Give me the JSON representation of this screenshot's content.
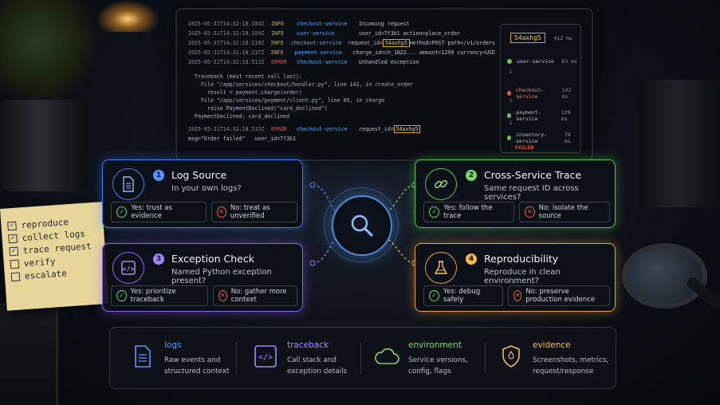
{
  "colors": {
    "blue": "#3f7cf0",
    "green": "#57c34a",
    "purple": "#8a5ff0",
    "orange": "#e3a12f",
    "error": "#e05a3c",
    "highlight": "#e0a22b"
  },
  "sticky_note": {
    "items": [
      {
        "label": "reproduce",
        "checked": true
      },
      {
        "label": "collect logs",
        "checked": true
      },
      {
        "label": "trace request",
        "checked": true
      },
      {
        "label": "verify",
        "checked": false
      },
      {
        "label": "escalate",
        "checked": false
      }
    ]
  },
  "terminal": {
    "log_lines": [
      {
        "ts": "2025-05-21T14:32:18.104Z",
        "level": "INFO",
        "service": "checkout-service",
        "msg": "Incoming request"
      },
      {
        "ts": "2025-05-21T14:32:18.109Z",
        "level": "INFO",
        "service": "user-service",
        "msg": "user_id=7f3b1  action=place_order"
      },
      {
        "ts": "2025-05-21T14:32:18.118Z",
        "level": "INFO",
        "service": "checkout-service",
        "msg_pre": "request_id=",
        "msg_hl": "54axhg5",
        "msg_post": "method=POST path=/v1/orders"
      },
      {
        "ts": "2025-05-21T14:32:18.237Z",
        "level": "INFO",
        "service": "payment-service",
        "msg": "charge_id=ch_1N22...  amount=1299  currency=USD"
      },
      {
        "ts": "2025-05-21T14:32:18.512Z",
        "level": "ERROR",
        "service": "checkout-service",
        "msg": "Unhandled exception"
      }
    ],
    "traceback": [
      "Traceback (most recent call last):",
      "  File \"/app/services/checkout/handler.py\", line 142, in create_order",
      "    result = payment.charge(order)",
      "  File \"/app/services/payment/client.py\", line 89, in charge",
      "    raise PaymentDeclined(\"card_declined\")",
      "PaymentDeclined: card_declined"
    ],
    "final_line": {
      "ts": "2025-05-21T14:32:18.515Z",
      "level": "ERROR",
      "service": "checkout-service",
      "msg_pre": "request_id=",
      "msg_hl": "54axhg5"
    },
    "final_line2": "msg=\"Order failed\"   user_id=7f3b1"
  },
  "trace_panel": {
    "trace_id": "54axhg5",
    "total": "412 ms",
    "nodes": [
      {
        "name": "user-service",
        "time": "63 ms",
        "failed": false
      },
      {
        "name": "checkout-service",
        "time": "142 ms",
        "failed": true
      },
      {
        "name": "payment-service",
        "time": "129 ms",
        "failed": false
      },
      {
        "name": "inventory-service",
        "time": "78 ms",
        "failed": false
      }
    ],
    "status": "FAILED"
  },
  "cards": [
    {
      "num": "1",
      "title": "Log Source",
      "question": "In your own logs?",
      "yes": "Yes: trust as evidence",
      "no": "No: treat as unverified",
      "icon": "document-icon"
    },
    {
      "num": "2",
      "title": "Cross-Service Trace",
      "question": "Same request ID across services?",
      "yes": "Yes: follow the trace",
      "no": "No: isolate the source",
      "icon": "link-icon"
    },
    {
      "num": "3",
      "title": "Exception Check",
      "question": "Named Python exception present?",
      "yes": "Yes: prioritize traceback",
      "no": "No: gather more context",
      "icon": "code-icon"
    },
    {
      "num": "4",
      "title": "Reproducibility",
      "question": "Reproduce in clean environment?",
      "yes": "Yes: debug safely",
      "no": "No: preserve production evidence",
      "icon": "flask-icon"
    }
  ],
  "hub": {
    "icon": "magnifier-icon"
  },
  "legend": [
    {
      "title": "logs",
      "desc1": "Raw events and",
      "desc2": "structured context",
      "color": "#5b92ff",
      "icon": "document-icon"
    },
    {
      "title": "traceback",
      "desc1": "Call stack and",
      "desc2": "exception details",
      "color": "#a585ff",
      "icon": "code-icon"
    },
    {
      "title": "environment",
      "desc1": "Service versions,",
      "desc2": "config, flags",
      "color": "#7ad66b",
      "icon": "cloud-icon"
    },
    {
      "title": "evidence",
      "desc1": "Screenshots, metrics,",
      "desc2": "request/response",
      "color": "#f1bb4b",
      "icon": "shield-icon"
    }
  ]
}
